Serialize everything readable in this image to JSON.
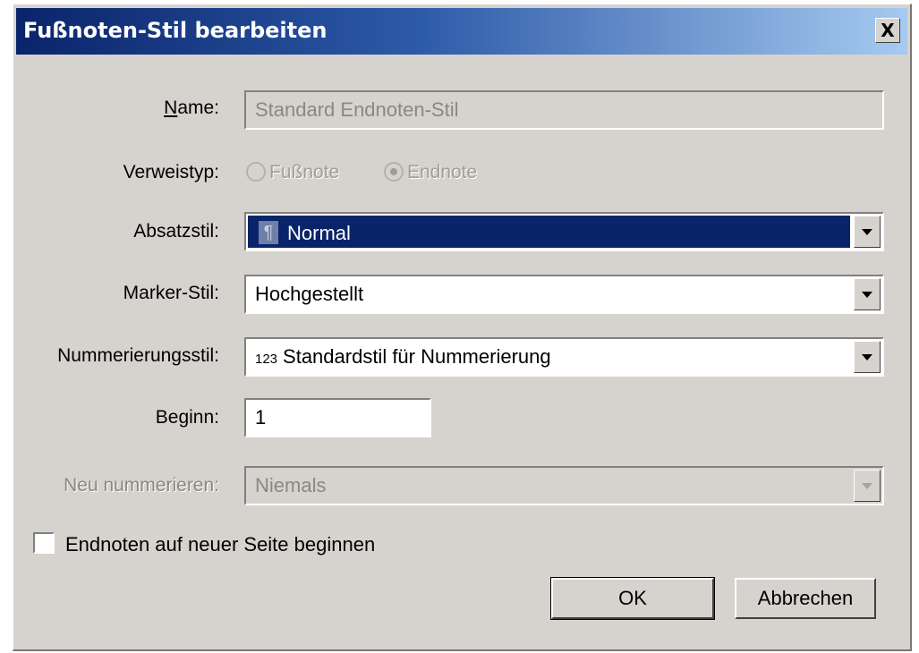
{
  "dialog": {
    "title": "Fußnoten-Stil bearbeiten",
    "close_label": "X"
  },
  "name": {
    "label_u": "N",
    "label_rest": "ame:",
    "value": "Standard Endnoten-Stil"
  },
  "verweistyp": {
    "label": "Verweistyp:",
    "options": [
      "Fußnote",
      "Endnote"
    ],
    "selected": "Endnote"
  },
  "absatzstil": {
    "label": "Absatzstil:",
    "value": "Normal",
    "icon": "pilcrow-icon"
  },
  "marker_stil": {
    "label": "Marker-Stil:",
    "value": "Hochgestellt"
  },
  "nummerierungsstil": {
    "label": "Nummerierungsstil:",
    "icon_text": "123",
    "value": "Standardstil für Nummerierung"
  },
  "beginn": {
    "label": "Beginn:",
    "value": "1"
  },
  "neu_nummerieren": {
    "label": "Neu nummerieren:",
    "value": "Niemals"
  },
  "checkbox": {
    "label": "Endnoten auf neuer Seite beginnen",
    "checked": false
  },
  "buttons": {
    "ok": "OK",
    "cancel": "Abbrechen"
  },
  "colors": {
    "title_start": "#0a246a",
    "title_end": "#a6caf0",
    "face": "#d6d3ce",
    "selection": "#0a246a"
  }
}
